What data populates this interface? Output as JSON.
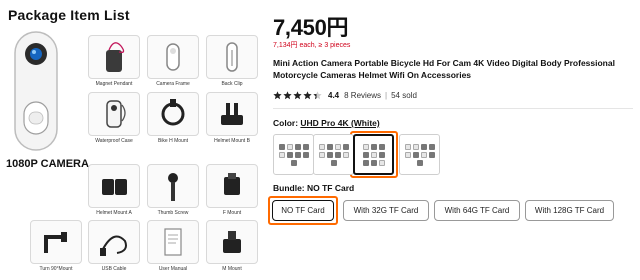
{
  "image": {
    "heading": "Package Item List",
    "camera_label": "1080P CAMERA",
    "items": [
      {
        "caption": "Magnet Pendant",
        "icon": "magnet-pendant-icon"
      },
      {
        "caption": "Camera Frame",
        "icon": "camera-frame-icon"
      },
      {
        "caption": "Back Clip",
        "icon": "back-clip-icon"
      },
      {
        "caption": "Waterproof Case",
        "icon": "waterproof-case-icon"
      },
      {
        "caption": "Bike H Mount",
        "icon": "bike-mount-icon"
      },
      {
        "caption": "Helmet Mount B",
        "icon": "helmet-mount-icon"
      },
      {
        "caption": "Helmet Mount A",
        "icon": "helmet-mount-icon"
      },
      {
        "caption": "Thumb Screw",
        "icon": "thumb-screw-icon"
      },
      {
        "caption": "F Mount",
        "icon": "f-mount-icon"
      },
      {
        "caption": "Turn 90°Mount",
        "icon": "turn-mount-icon"
      },
      {
        "caption": "USB Cable",
        "icon": "usb-cable-icon"
      },
      {
        "caption": "User Manual",
        "icon": "user-manual-icon"
      },
      {
        "caption": "M Mount",
        "icon": "m-mount-icon"
      }
    ]
  },
  "product": {
    "price": "7,450円",
    "price_note": "7,134円 each, ≥ 3 pieces",
    "title": "Mini Action Camera Portable Bicycle Hd For Cam 4K Video Digital Body Professional Motorcycle Cameras Helmet Wifi On Accessories",
    "rating": "4.4",
    "rating_stars": 4.4,
    "reviews": "8 Reviews",
    "sold": "54 sold"
  },
  "variants": {
    "color_label": "Color:",
    "color_value": "UHD Pro 4K (White)",
    "selected_swatch": 2,
    "swatches": 4,
    "bundle_label": "Bundle: NO TF Card",
    "bundles": [
      "NO TF Card",
      "With 32G TF Card",
      "With 64G TF Card",
      "With 128G TF Card"
    ],
    "selected_bundle": 0
  },
  "colors": {
    "accent_highlight": "#ff6a00",
    "price_note": "#d0021b",
    "star": "#222222"
  }
}
